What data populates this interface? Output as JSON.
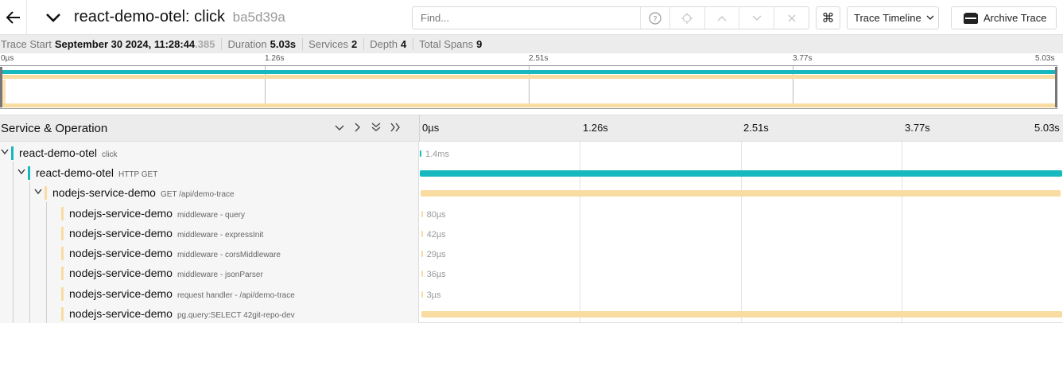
{
  "header": {
    "trace_name": "react-demo-otel: click",
    "trace_id": "ba5d39a",
    "find_placeholder": "Find...",
    "view_select": "Trace Timeline",
    "archive_label": "Archive Trace"
  },
  "meta": {
    "trace_start_label": "Trace Start",
    "trace_start_value": "September 30 2024, 11:28:44",
    "trace_start_ms": ".385",
    "duration_label": "Duration",
    "duration_value": "5.03s",
    "services_label": "Services",
    "services_value": "2",
    "depth_label": "Depth",
    "depth_value": "4",
    "total_spans_label": "Total Spans",
    "total_spans_value": "9"
  },
  "minimap": {
    "ticks": [
      "0µs",
      "1.26s",
      "2.51s",
      "3.77s",
      "5.03s"
    ]
  },
  "table": {
    "header_title": "Service & Operation",
    "ticks": [
      "0µs",
      "1.26s",
      "2.51s",
      "3.77s",
      "5.03s"
    ]
  },
  "colors": {
    "react_service": "#17b8be",
    "node_service": "#f8dcA1"
  },
  "spans": [
    {
      "service": "react-demo-otel",
      "operation": "click",
      "duration": "1.4ms",
      "depth": 0,
      "start": 0.0,
      "end": 0.0003,
      "color": "#17b8be",
      "toggle": "expanded"
    },
    {
      "service": "react-demo-otel",
      "operation": "HTTP GET",
      "duration": "",
      "depth": 1,
      "start": 0.0,
      "end": 1.0,
      "color": "#17b8be",
      "toggle": "expanded"
    },
    {
      "service": "nodejs-service-demo",
      "operation": "GET /api/demo-trace",
      "duration": "",
      "depth": 2,
      "start": 0.001,
      "end": 0.998,
      "color": "#f8dca1",
      "toggle": "expanded"
    },
    {
      "service": "nodejs-service-demo",
      "operation": "middleware - query",
      "duration": "80µs",
      "depth": 3,
      "start": 0.002,
      "end": 0.0021,
      "color": "#f8dca1",
      "toggle": "none"
    },
    {
      "service": "nodejs-service-demo",
      "operation": "middleware - expressInit",
      "duration": "42µs",
      "depth": 3,
      "start": 0.002,
      "end": 0.0021,
      "color": "#f8dca1",
      "toggle": "none"
    },
    {
      "service": "nodejs-service-demo",
      "operation": "middleware - corsMiddleware",
      "duration": "29µs",
      "depth": 3,
      "start": 0.002,
      "end": 0.0021,
      "color": "#f8dca1",
      "toggle": "none"
    },
    {
      "service": "nodejs-service-demo",
      "operation": "middleware - jsonParser",
      "duration": "36µs",
      "depth": 3,
      "start": 0.002,
      "end": 0.0021,
      "color": "#f8dca1",
      "toggle": "none"
    },
    {
      "service": "nodejs-service-demo",
      "operation": "request handler - /api/demo-trace",
      "duration": "3µs",
      "depth": 3,
      "start": 0.002,
      "end": 0.0021,
      "color": "#f8dca1",
      "toggle": "none"
    },
    {
      "service": "nodejs-service-demo",
      "operation": "pg.query:SELECT 42git-repo-dev",
      "duration": "",
      "depth": 3,
      "start": 0.003,
      "end": 1.0,
      "color": "#f8dca1",
      "toggle": "none"
    }
  ]
}
